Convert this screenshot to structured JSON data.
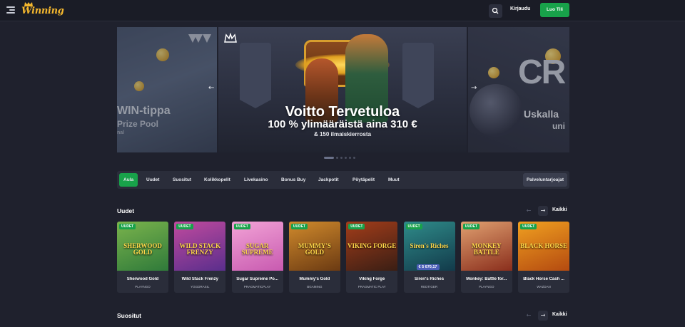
{
  "header": {
    "logo_text": "Winning",
    "login_label": "Kirjaudu",
    "signup_label": "Luo Tili"
  },
  "hero": {
    "left_slide": {
      "title": "WIN-tippa",
      "subtitle": "Prize Pool",
      "line3": "nal"
    },
    "main_slide": {
      "title": "Voitto Tervetuloa",
      "subtitle": "100 % ylimääräistä aina 310 €",
      "line3": "& 150 ilmaiskierrosta"
    },
    "right_slide": {
      "big_text": "CR",
      "title": "Uskalla",
      "subtitle": "uni"
    },
    "dots_count": 6,
    "active_dot": 0
  },
  "tabs": {
    "items": [
      "Aula",
      "Uudet",
      "Suositut",
      "Kolikkopelit",
      "Livekasino",
      "Bonus Buy",
      "Jackpotit",
      "Pöytäpelit",
      "Muut"
    ],
    "active": "Aula",
    "providers_label": "Palveluntarjoajat"
  },
  "sections": {
    "new": {
      "title": "Uudet",
      "all_label": "Kaikki",
      "games": [
        {
          "name": "Sherwood Gold",
          "provider": "PLAYNGO",
          "badge": "UUDET",
          "art": "SHERWOOD GOLD",
          "color1": "#2f7a3a",
          "color2": "#7ab34c"
        },
        {
          "name": "Wild Stack Frenzy",
          "provider": "YGGDRASIL",
          "badge": "UUDET",
          "art": "WILD STACK FRENZY",
          "color1": "#5a2e8c",
          "color2": "#c04a9e"
        },
        {
          "name": "Sugar Supreme Po...",
          "provider": "PRAGMATICPLAY",
          "badge": "UUDET",
          "art": "SUGAR SUPREME",
          "color1": "#c85ab0",
          "color2": "#f2a3d6"
        },
        {
          "name": "Mummy's Gold",
          "provider": "BGAMING",
          "badge": "UUDET",
          "art": "MUMMY'S GOLD",
          "color1": "#6b3a12",
          "color2": "#d08a2c"
        },
        {
          "name": "Viking Forge",
          "provider": "PRAGMATIC PLAY",
          "badge": "UUDET",
          "art": "VIKING FORGE",
          "color1": "#3a1e14",
          "color2": "#a33d1a"
        },
        {
          "name": "Siren's Riches",
          "provider": "REDTIGER",
          "badge": "UUDET",
          "art": "Siren's Riches",
          "color1": "#123a4a",
          "color2": "#2f8c8a",
          "jackpot": "€ 5 670,17"
        },
        {
          "name": "Monkey: Battle for...",
          "provider": "PLAYNGO",
          "badge": "UUDET",
          "art": "MONKEY BATTLE",
          "color1": "#8a2e1c",
          "color2": "#e0a070"
        },
        {
          "name": "Black Horse Cash ...",
          "provider": "WAZDAN",
          "badge": "UUDET",
          "art": "BLACK HORSE",
          "color1": "#b44a10",
          "color2": "#f0a020"
        }
      ]
    },
    "popular": {
      "title": "Suositut",
      "all_label": "Kaikki"
    }
  },
  "colors": {
    "background": "#1f212d",
    "accent_green": "#18a24a",
    "logo_gold": "#f5b82e"
  }
}
